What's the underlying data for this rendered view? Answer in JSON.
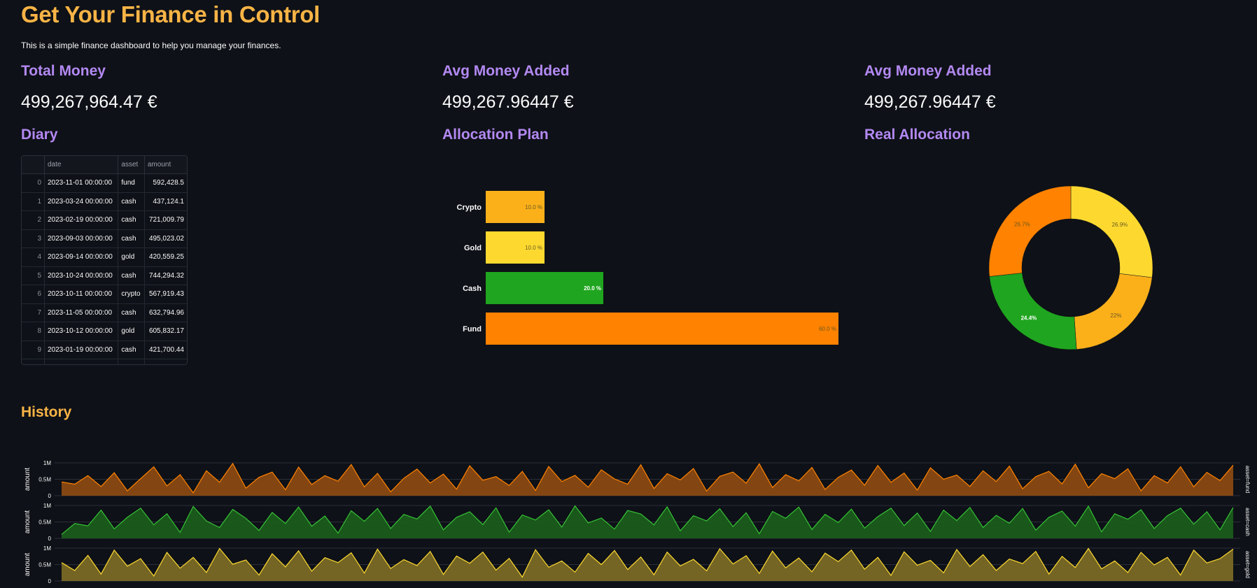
{
  "header": {
    "title": "Get Your Finance in Control",
    "subtitle": "This is a simple finance dashboard to help you manage your finances."
  },
  "metrics": [
    {
      "label": "Total Money",
      "value": "499,267,964.47 €"
    },
    {
      "label": "Avg Money Added",
      "value": "499,267.96447 €"
    },
    {
      "label": "Avg Money Added",
      "value": "499,267.96447 €"
    }
  ],
  "sections": {
    "diary": "Diary",
    "plan": "Allocation Plan",
    "real": "Real Allocation",
    "history": "History"
  },
  "diary": {
    "columns": [
      "",
      "date",
      "asset",
      "amount"
    ],
    "rows": [
      [
        "0",
        "2023-11-01 00:00:00",
        "fund",
        "592,428.5"
      ],
      [
        "1",
        "2023-03-24 00:00:00",
        "cash",
        "437,124.1"
      ],
      [
        "2",
        "2023-02-19 00:00:00",
        "cash",
        "721,009.79"
      ],
      [
        "3",
        "2023-09-03 00:00:00",
        "cash",
        "495,023.02"
      ],
      [
        "4",
        "2023-09-14 00:00:00",
        "gold",
        "420,559.25"
      ],
      [
        "5",
        "2023-10-24 00:00:00",
        "cash",
        "744,294.32"
      ],
      [
        "6",
        "2023-10-11 00:00:00",
        "crypto",
        "567,919.43"
      ],
      [
        "7",
        "2023-11-05 00:00:00",
        "cash",
        "632,794.96"
      ],
      [
        "8",
        "2023-10-12 00:00:00",
        "gold",
        "605,832.17"
      ],
      [
        "9",
        "2023-01-19 00:00:00",
        "cash",
        "421,700.44"
      ]
    ]
  },
  "colors": {
    "crypto": "#fbb01a",
    "gold": "#fdd930",
    "cash": "#1fa51f",
    "fund": "#ff8200"
  },
  "chart_data": [
    {
      "type": "bar",
      "orientation": "horizontal",
      "title": "Allocation Plan",
      "categories": [
        "Crypto",
        "Gold",
        "Cash",
        "Fund"
      ],
      "values": [
        10.0,
        10.0,
        20.0,
        60.0
      ],
      "labels": [
        "10.0 %",
        "10.0 %",
        "20.0 %",
        "60.0 %"
      ],
      "unit": "%"
    },
    {
      "type": "pie",
      "title": "Real Allocation",
      "donut": true,
      "categories": [
        "gold",
        "crypto",
        "cash",
        "fund"
      ],
      "values": [
        26.9,
        22,
        24.4,
        26.7
      ],
      "labels": [
        "26.9%",
        "22%",
        "24.4%",
        "26.7%"
      ]
    },
    {
      "type": "area",
      "title": "History",
      "ylabel": "amount",
      "yticks": [
        "0",
        "0.5M",
        "1M"
      ],
      "ylim": [
        0,
        1000000
      ],
      "facets": [
        {
          "name": "asset=fund",
          "color": "#ff8200",
          "fill": "#8a4a12",
          "values": [
            420000,
            350000,
            610000,
            280000,
            700000,
            150000,
            520000,
            880000,
            300000,
            640000,
            90000,
            760000,
            410000,
            980000,
            230000,
            560000,
            720000,
            180000,
            870000,
            340000,
            610000,
            440000,
            950000,
            270000,
            680000,
            120000,
            530000,
            810000,
            390000,
            660000,
            200000,
            910000,
            470000,
            580000,
            310000,
            740000,
            160000,
            890000,
            430000,
            620000,
            260000,
            790000,
            510000,
            350000,
            940000,
            220000,
            670000,
            480000,
            830000,
            140000,
            590000,
            720000,
            380000,
            970000,
            250000,
            640000,
            450000,
            860000,
            190000,
            560000,
            780000,
            320000,
            920000,
            410000,
            690000,
            170000,
            850000,
            500000,
            630000,
            280000,
            760000,
            430000,
            900000,
            210000,
            580000,
            740000,
            360000,
            960000,
            240000,
            670000,
            520000,
            820000,
            150000,
            610000,
            390000,
            880000,
            270000,
            710000,
            460000,
            930000
          ]
        },
        {
          "name": "asset=cash",
          "color": "#35c235",
          "fill": "#1b5c1b",
          "values": [
            120000,
            450000,
            380000,
            860000,
            290000,
            640000,
            920000,
            410000,
            750000,
            180000,
            970000,
            530000,
            330000,
            880000,
            610000,
            240000,
            790000,
            450000,
            950000,
            370000,
            680000,
            160000,
            840000,
            520000,
            910000,
            300000,
            730000,
            590000,
            980000,
            260000,
            640000,
            810000,
            420000,
            930000,
            190000,
            710000,
            560000,
            870000,
            340000,
            990000,
            470000,
            620000,
            280000,
            850000,
            740000,
            410000,
            960000,
            230000,
            690000,
            530000,
            900000,
            360000,
            780000,
            140000,
            820000,
            610000,
            950000,
            270000,
            730000,
            480000,
            890000,
            310000,
            660000,
            920000,
            390000,
            770000,
            210000,
            860000,
            540000,
            940000,
            330000,
            700000,
            460000,
            910000,
            250000,
            640000,
            830000,
            370000,
            980000,
            200000,
            750000,
            580000,
            870000,
            300000,
            690000,
            920000,
            430000,
            810000,
            260000,
            940000
          ]
        },
        {
          "name": "asset=gold",
          "color": "#fdd930",
          "fill": "#7a6a25",
          "values": [
            560000,
            320000,
            780000,
            210000,
            940000,
            450000,
            680000,
            150000,
            870000,
            390000,
            720000,
            260000,
            990000,
            510000,
            640000,
            180000,
            830000,
            430000,
            920000,
            300000,
            710000,
            560000,
            860000,
            240000,
            970000,
            380000,
            650000,
            470000,
            900000,
            200000,
            760000,
            540000,
            880000,
            330000,
            690000,
            120000,
            950000,
            420000,
            610000,
            270000,
            840000,
            500000,
            930000,
            350000,
            730000,
            190000,
            880000,
            460000,
            660000,
            310000,
            980000,
            520000,
            770000,
            230000,
            910000,
            400000,
            700000,
            280000,
            850000,
            590000,
            940000,
            360000,
            720000,
            170000,
            890000,
            480000,
            630000,
            250000,
            960000,
            440000,
            800000,
            320000,
            670000,
            530000,
            900000,
            210000,
            750000,
            410000,
            990000,
            370000,
            610000,
            260000,
            870000,
            490000,
            720000,
            180000,
            940000,
            550000,
            680000,
            970000
          ]
        }
      ]
    }
  ]
}
